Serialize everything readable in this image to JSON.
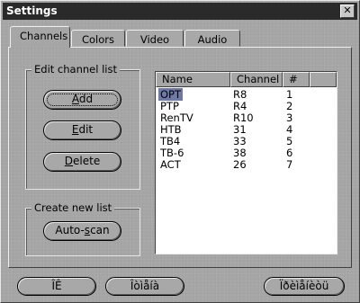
{
  "window": {
    "title": "Settings",
    "close_glyph": "✕"
  },
  "tabs": [
    {
      "label": "Channels",
      "active": true
    },
    {
      "label": "Colors",
      "active": false
    },
    {
      "label": "Video",
      "active": false
    },
    {
      "label": "Audio",
      "active": false
    }
  ],
  "edit_group": {
    "label": "Edit channel list",
    "add_label": "Add",
    "add_underline": "A",
    "add_rest": "dd",
    "edit_label": "Edit",
    "edit_underline": "E",
    "edit_rest": "dit",
    "delete_label": "Delete",
    "delete_underline": "D",
    "delete_rest": "elete"
  },
  "create_group": {
    "label": "Create new list",
    "autoscan_pre": "Auto-",
    "autoscan_underline": "s",
    "autoscan_post": "can"
  },
  "list": {
    "columns": [
      "Name",
      "Channel",
      "#"
    ],
    "rows": [
      {
        "name": "OPT",
        "channel": "R8",
        "num": "1",
        "selected": true
      },
      {
        "name": "PTP",
        "channel": "R4",
        "num": "2"
      },
      {
        "name": "RenTV",
        "channel": "R10",
        "num": "3"
      },
      {
        "name": "HTB",
        "channel": "31",
        "num": "4"
      },
      {
        "name": "TB4",
        "channel": "33",
        "num": "5"
      },
      {
        "name": "TB-6",
        "channel": "38",
        "num": "6"
      },
      {
        "name": "ACT",
        "channel": "26",
        "num": "7"
      }
    ]
  },
  "footer": {
    "ok_label": "ÎÊ",
    "cancel_label": "Îòìåíà",
    "apply_label": "Ïðèìåíèòü"
  }
}
